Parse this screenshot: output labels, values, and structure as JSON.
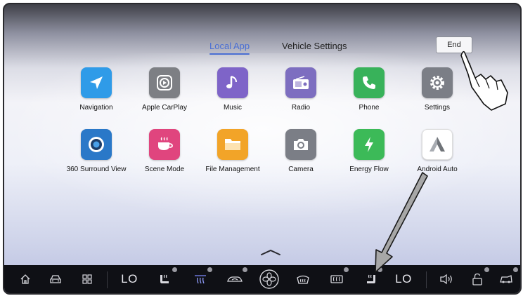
{
  "tabs": {
    "local_app": "Local App",
    "vehicle_settings": "Vehicle Settings"
  },
  "end_button": "End",
  "apps": [
    {
      "label": "Navigation",
      "icon": "navigation-icon",
      "color": "#2f9be8"
    },
    {
      "label": "Apple CarPlay",
      "icon": "carplay-icon",
      "color": "#7d7f84"
    },
    {
      "label": "Music",
      "icon": "music-icon",
      "color": "#7e64c8"
    },
    {
      "label": "Radio",
      "icon": "radio-icon",
      "color": "#7d6ec0"
    },
    {
      "label": "Phone",
      "icon": "phone-icon",
      "color": "#38b25a"
    },
    {
      "label": "Settings",
      "icon": "settings-icon",
      "color": "#7b7e86"
    },
    {
      "label": "360 Surround View",
      "icon": "surround-view-icon",
      "color": "#2a78c8"
    },
    {
      "label": "Scene Mode",
      "icon": "scene-mode-icon",
      "color": "#e0457e"
    },
    {
      "label": "File Management",
      "icon": "folder-icon",
      "color": "#f2a428"
    },
    {
      "label": "Camera",
      "icon": "camera-icon",
      "color": "#7b7e86"
    },
    {
      "label": "Energy Flow",
      "icon": "energy-flow-icon",
      "color": "#3cba58"
    },
    {
      "label": "Android Auto",
      "icon": "android-auto-icon",
      "color": "#ffffff"
    }
  ],
  "bottom_bar": {
    "left_temp": "LO",
    "right_temp": "LO"
  }
}
